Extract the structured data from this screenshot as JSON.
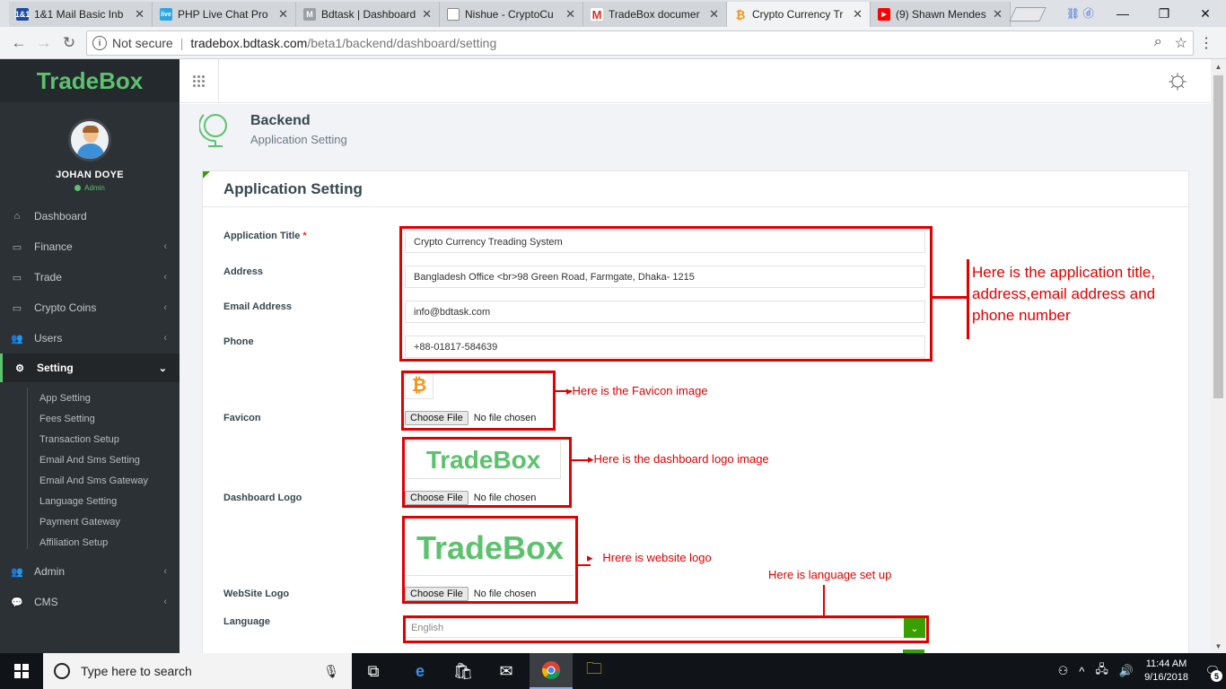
{
  "browser": {
    "tabs": [
      {
        "title": "1&1 Mail Basic Inb",
        "favicon": "1&1",
        "favicon_color": "#1c4aa0"
      },
      {
        "title": "PHP Live Chat Pro",
        "favicon": "live",
        "favicon_color": "#2aa6e0"
      },
      {
        "title": "Bdtask | Dashboard",
        "favicon": "M",
        "favicon_color": "#9aa0a6"
      },
      {
        "title": "Nishue - CryptoCu",
        "favicon": "▫",
        "favicon_color": "#9aa0a6"
      },
      {
        "title": "TradeBox documer",
        "favicon": "M",
        "favicon_color": "#d93025"
      },
      {
        "title": "Crypto Currency Tr",
        "favicon": "₿",
        "favicon_color": "#f7931a"
      },
      {
        "title": "(9) Shawn Mendes",
        "favicon": "▶",
        "favicon_color": "#ff0000"
      }
    ],
    "omnibox": {
      "security": "Not secure",
      "host": "tradebox.bdtask.com",
      "path": "/beta1/backend/dashboard/setting"
    }
  },
  "sidebar": {
    "brand": "TradeBox",
    "user": {
      "name": "JOHAN DOYE",
      "role": "Admin"
    },
    "menu": [
      {
        "label": "Dashboard",
        "icon": "home-icon"
      },
      {
        "label": "Finance",
        "icon": "card-icon"
      },
      {
        "label": "Trade",
        "icon": "card-icon"
      },
      {
        "label": "Crypto Coins",
        "icon": "card-icon"
      },
      {
        "label": "Users",
        "icon": "users-icon"
      },
      {
        "label": "Setting",
        "icon": "gear-icon"
      },
      {
        "label": "Admin",
        "icon": "users-icon"
      },
      {
        "label": "CMS",
        "icon": "comment-icon"
      }
    ],
    "setting_submenu": [
      "App Setting",
      "Fees Setting",
      "Transaction Setup",
      "Email And Sms Setting",
      "Email And Sms Gateway",
      "Language Setting",
      "Payment Gateway",
      "Affiliation Setup"
    ]
  },
  "header": {
    "title": "Backend",
    "subtitle": "Application Setting"
  },
  "form": {
    "heading": "Application Setting",
    "labels": {
      "title": "Application Title",
      "required_mark": "*",
      "address": "Address",
      "email": "Email Address",
      "phone": "Phone",
      "favicon": "Favicon",
      "dashboard_logo": "Dashboard Logo",
      "website_logo": "WebSite Logo",
      "language": "Language"
    },
    "values": {
      "title": "Crypto Currency Treading System",
      "address": "Bangladesh Office <br>98 Green Road, Farmgate, Dhaka- 1215",
      "email": "info@bdtask.com",
      "phone": "+88-01817-584639",
      "language": "English"
    },
    "file_button": "Choose File",
    "file_status": "No file chosen",
    "logo_text": "TradeBox",
    "favicon_glyph": "₿"
  },
  "annotations": {
    "info": "Here is the application title, address,email address and phone number",
    "favicon": "Here is the Favicon image",
    "dashboard_logo": "Here is the dashboard logo image",
    "website_logo": "Hrere is website logo",
    "language": "Here is language set up"
  },
  "taskbar": {
    "search_placeholder": "Type here to search",
    "time": "11:44 AM",
    "date": "9/16/2018",
    "notification_count": "5"
  },
  "colors": {
    "brand_green": "#5cc26e",
    "accent_green": "#37a000",
    "sidebar_bg": "#2c3136",
    "annotation_red": "#e00000"
  }
}
